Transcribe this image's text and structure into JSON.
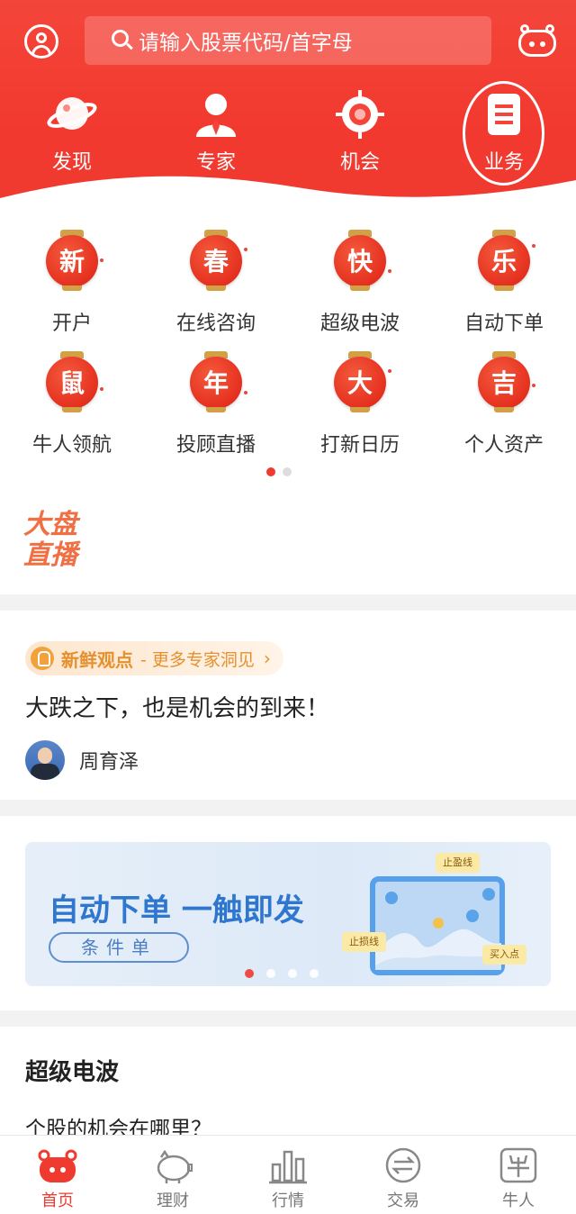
{
  "header": {
    "search_placeholder": "请输入股票代码/首字母",
    "nav": [
      {
        "label": "发现",
        "icon": "planet-icon"
      },
      {
        "label": "专家",
        "icon": "expert-icon"
      },
      {
        "label": "机会",
        "icon": "target-icon"
      },
      {
        "label": "业务",
        "icon": "document-icon"
      }
    ],
    "active_nav": "发现",
    "accent": "#ef3a30"
  },
  "grid": {
    "items": [
      {
        "glyph": "新",
        "label": "开户"
      },
      {
        "glyph": "春",
        "label": "在线咨询"
      },
      {
        "glyph": "快",
        "label": "超级电波"
      },
      {
        "glyph": "乐",
        "label": "自动下单"
      },
      {
        "glyph": "鼠",
        "label": "牛人领航"
      },
      {
        "glyph": "年",
        "label": "投顾直播"
      },
      {
        "glyph": "大",
        "label": "打新日历"
      },
      {
        "glyph": "吉",
        "label": "个人资产"
      }
    ],
    "page_current": 1,
    "page_total": 2
  },
  "dapan": {
    "line1": "大盘",
    "line2": "直播"
  },
  "insight": {
    "tag_title": "新鲜观点",
    "tag_more": "- 更多专家洞见",
    "chevron": "›",
    "headline": "大跌之下，也是机会的到来！",
    "author": "周育泽"
  },
  "banner": {
    "title": "自动下单 一触即发",
    "button": "条件单",
    "chips": {
      "stop_profit": "止盈线",
      "stop_loss": "止损线",
      "buy_point": "买入点"
    },
    "dots_total": 4,
    "dot_current": 1
  },
  "section": {
    "title": "超级电波",
    "subtitle": "个股的机会在哪里？"
  },
  "tabbar": {
    "tabs": [
      {
        "label": "首页",
        "icon": "robot-home-icon"
      },
      {
        "label": "理财",
        "icon": "piggy-bank-icon"
      },
      {
        "label": "行情",
        "icon": "bar-chart-icon"
      },
      {
        "label": "交易",
        "icon": "exchange-icon"
      },
      {
        "label": "牛人",
        "icon": "bull-icon"
      }
    ],
    "active": "首页"
  }
}
